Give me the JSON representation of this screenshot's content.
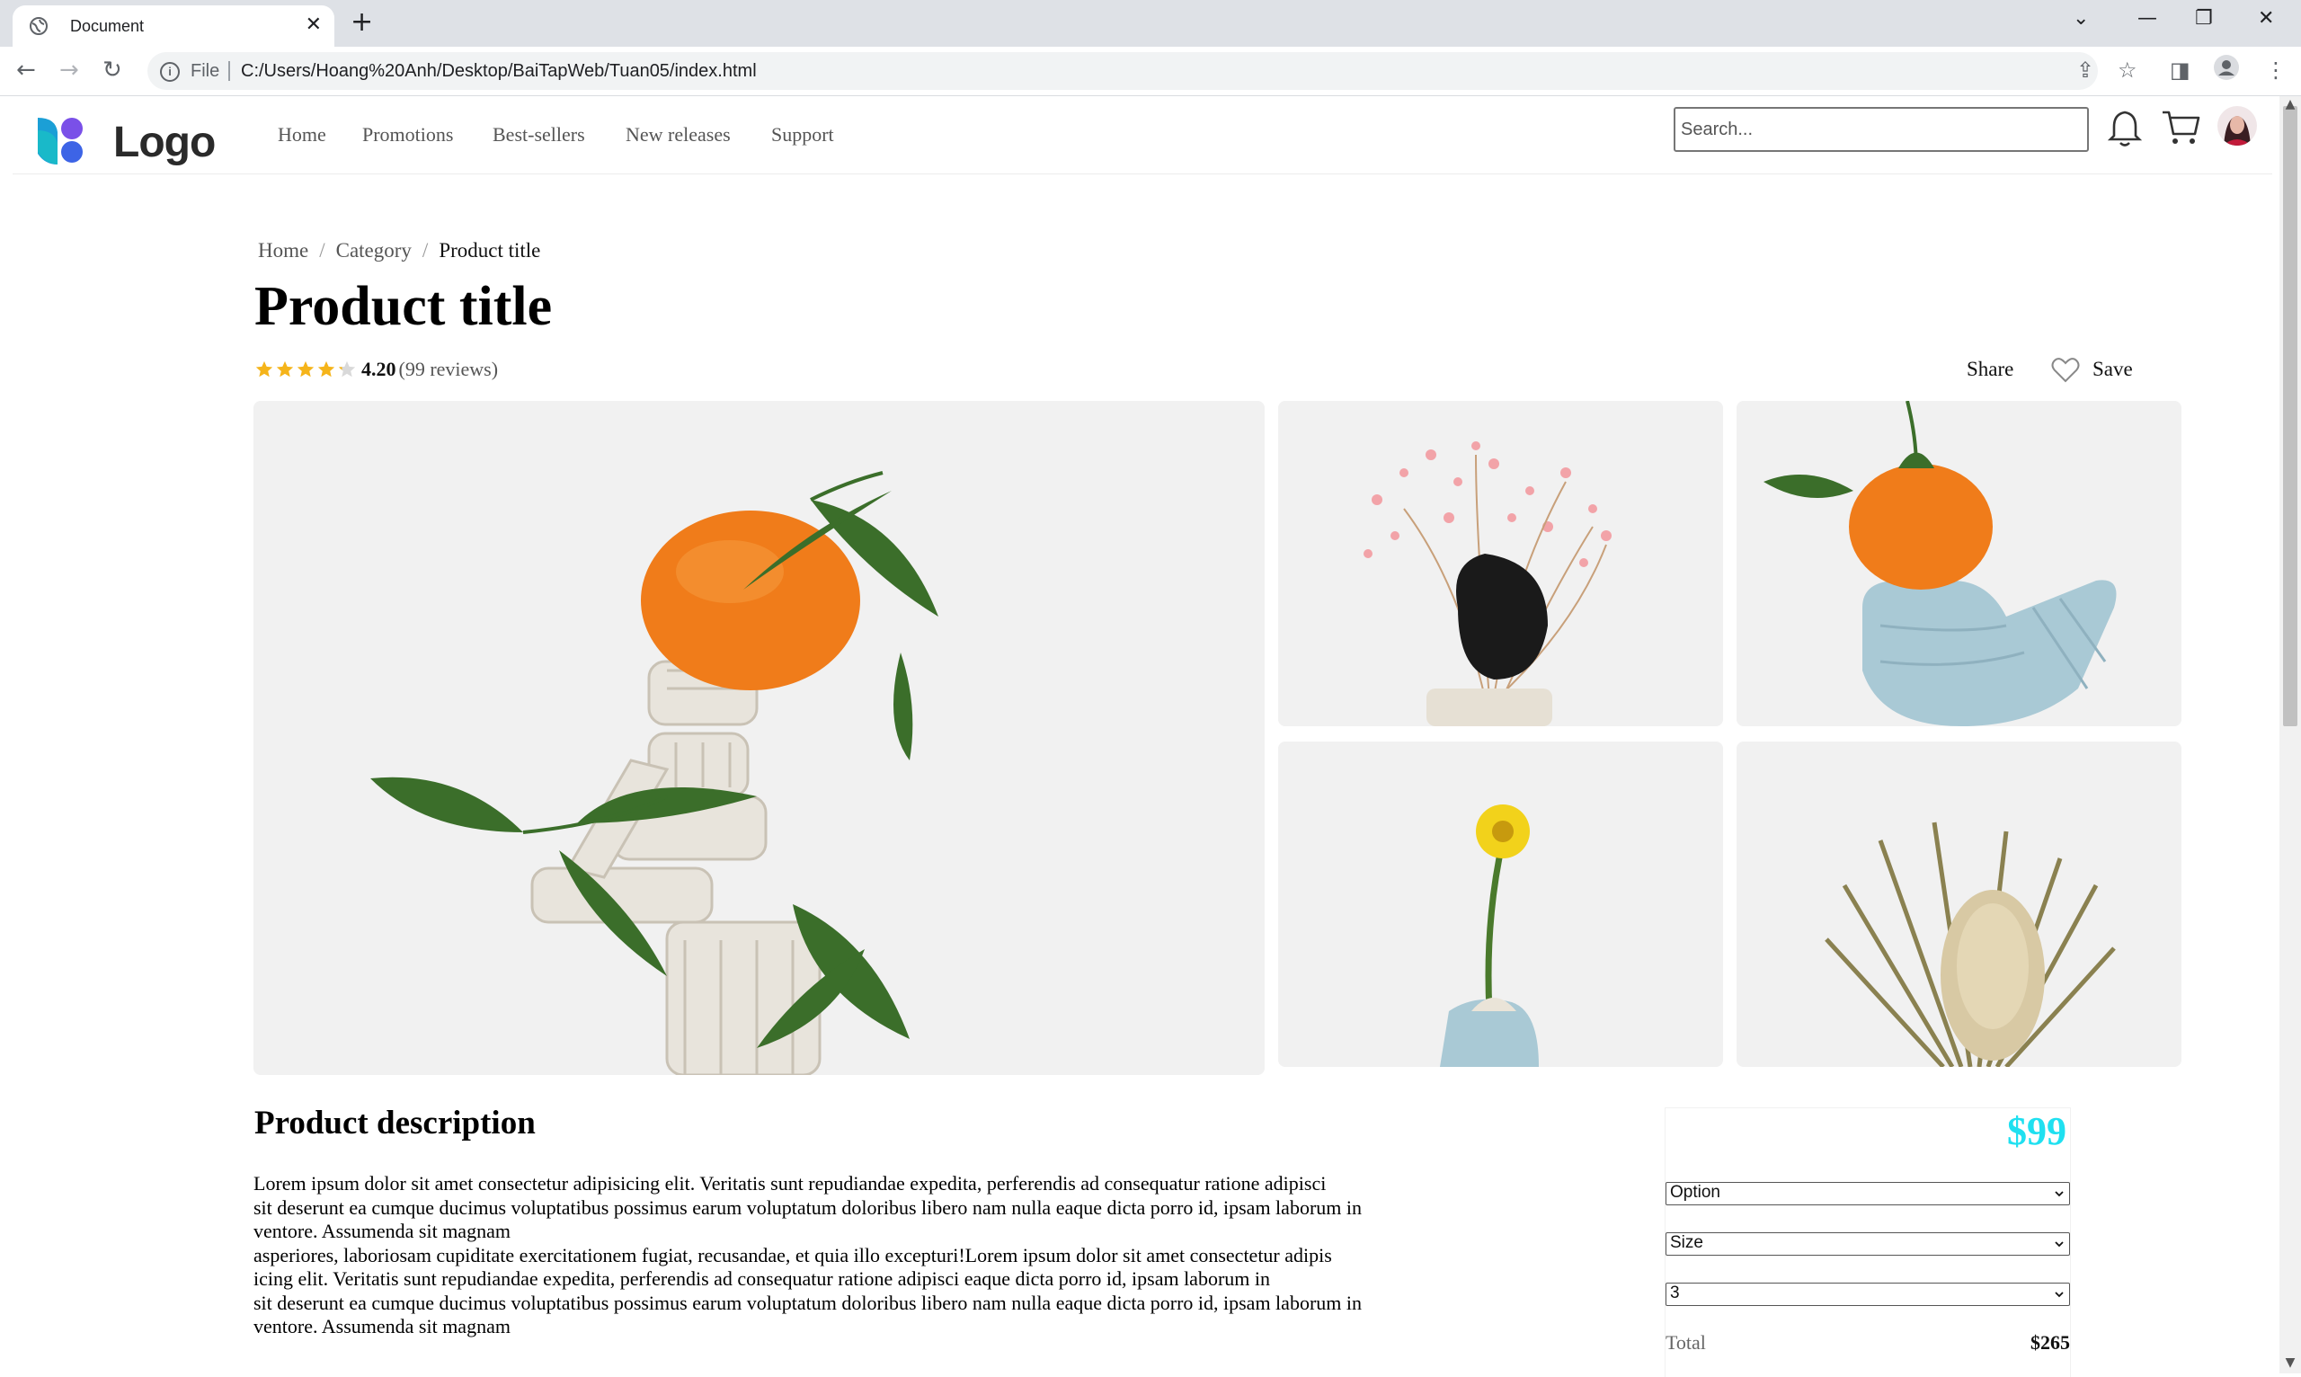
{
  "browser": {
    "tab_title": "Document",
    "tab_close": "✕",
    "new_tab": "+",
    "address_scheme": "File",
    "address_url": "C:/Users/Hoang%20Anh/Desktop/BaiTapWeb/Tuan05/index.html"
  },
  "header": {
    "logo_text": "Logo",
    "nav": [
      "Home",
      "Promotions",
      "Best-sellers",
      "New releases",
      "Support"
    ],
    "search_placeholder": "Search..."
  },
  "breadcrumb": [
    "Home",
    "Category",
    "Product title"
  ],
  "product": {
    "title": "Product title",
    "rating": "4.20",
    "rating_value": 4.2,
    "reviews": "(99 reviews)",
    "share_label": "Share",
    "save_label": "Save"
  },
  "description": {
    "heading": "Product description",
    "lines": [
      "Lorem ipsum dolor sit amet consectetur adipisicing elit. Veritatis sunt repudiandae expedita, perferendis ad consequatur ratione adipisci",
      "sit deserunt ea cumque ducimus voluptatibus possimus earum voluptatum doloribus libero nam nulla eaque dicta porro id, ipsam laborum in",
      "ventore. Assumenda sit magnam",
      "asperiores, laboriosam cupiditate exercitationem fugiat, recusandae, et quia illo excepturi!Lorem ipsum dolor sit amet consectetur adipis",
      "icing elit. Veritatis sunt repudiandae expedita, perferendis ad consequatur ratione adipisci eaque dicta porro id, ipsam laborum in",
      "sit deserunt ea cumque ducimus voluptatibus possimus earum voluptatum doloribus libero nam nulla eaque dicta porro id, ipsam laborum in",
      "ventore. Assumenda sit magnam"
    ]
  },
  "purchase": {
    "price": "$99",
    "price_color": "#1fe0f0",
    "option_select": "Option",
    "size_select": "Size",
    "quantity_select": "3",
    "total_label": "Total",
    "total_value": "$265"
  },
  "colors": {
    "star": "#f5b41a",
    "photo_bg": "#f1f1f1"
  }
}
